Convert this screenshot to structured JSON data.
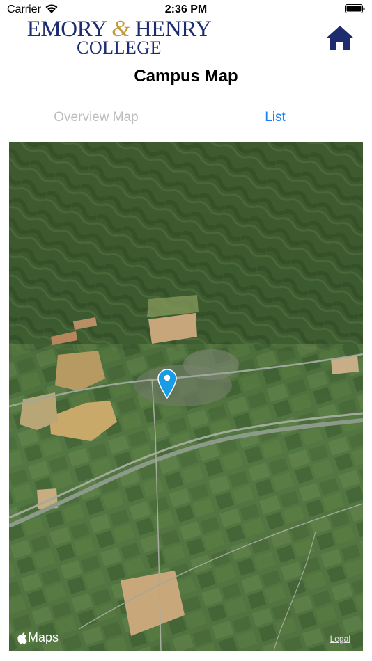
{
  "status_bar": {
    "carrier": "Carrier",
    "time": "2:36 PM"
  },
  "header": {
    "logo_line1_left": "EMORY",
    "logo_ampersand": "&",
    "logo_line1_right": "HENRY",
    "logo_line2": "COLLEGE",
    "home_icon": "home-icon",
    "brand_color": "#1d2c6e"
  },
  "page": {
    "title": "Campus Map"
  },
  "tabs": [
    {
      "label": "Overview Map",
      "selected": false
    },
    {
      "label": "List",
      "selected": true
    }
  ],
  "map": {
    "style": "satellite",
    "pin_icon": "map-pin-icon",
    "pin_color": "#1a9be6",
    "attribution": "Maps",
    "legal_label": "Legal"
  }
}
